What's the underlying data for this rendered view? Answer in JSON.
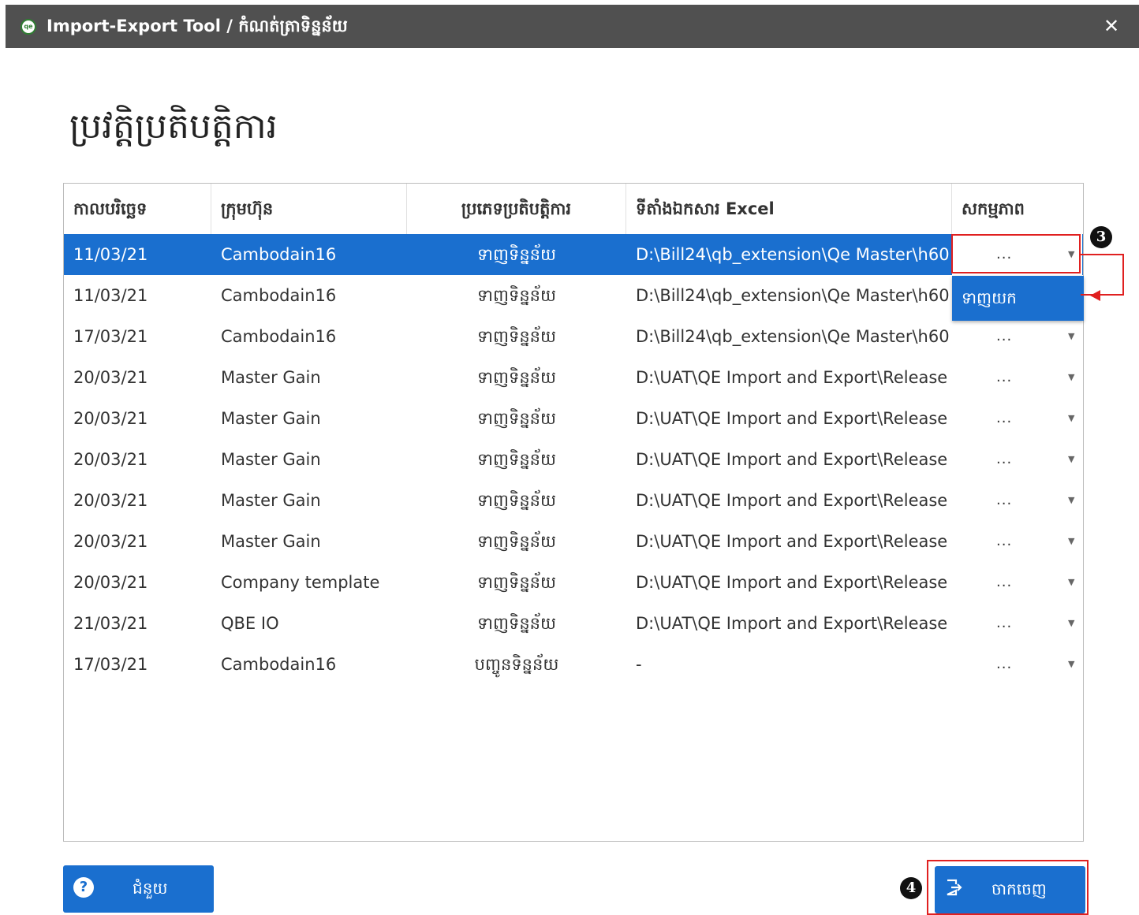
{
  "window": {
    "title": "Import-Export Tool / កំណត់ត្រាទិន្នន័យ",
    "logo_text": "qe",
    "close_glyph": "✕"
  },
  "page": {
    "title": "ប្រវត្តិប្រតិបត្តិការ"
  },
  "table": {
    "headers": [
      "កាលបរិច្ឆេទ",
      "ក្រុមហ៊ុន",
      "ប្រភេទប្រតិបត្តិការ",
      "ទីតាំងឯកសារ Excel",
      "សកម្មភាព"
    ],
    "rows": [
      {
        "date": "11/03/21",
        "company": "Cambodain16",
        "type": "ទាញទិន្នន័យ",
        "path": "D:\\Bill24\\qb_extension\\Qe Master\\h60:",
        "action": "...",
        "selected": true
      },
      {
        "date": "11/03/21",
        "company": "Cambodain16",
        "type": "ទាញទិន្នន័យ",
        "path": "D:\\Bill24\\qb_extension\\Qe Master\\h60:",
        "action": "..."
      },
      {
        "date": "17/03/21",
        "company": "Cambodain16",
        "type": "ទាញទិន្នន័យ",
        "path": "D:\\Bill24\\qb_extension\\Qe Master\\h60:",
        "action": "..."
      },
      {
        "date": "20/03/21",
        "company": "Master Gain",
        "type": "ទាញទិន្នន័យ",
        "path": "D:\\UAT\\QE Import and Export\\Release",
        "action": "..."
      },
      {
        "date": "20/03/21",
        "company": "Master Gain",
        "type": "ទាញទិន្នន័យ",
        "path": "D:\\UAT\\QE Import and Export\\Release",
        "action": "..."
      },
      {
        "date": "20/03/21",
        "company": "Master Gain",
        "type": "ទាញទិន្នន័យ",
        "path": "D:\\UAT\\QE Import and Export\\Release",
        "action": "..."
      },
      {
        "date": "20/03/21",
        "company": "Master Gain",
        "type": "ទាញទិន្នន័យ",
        "path": "D:\\UAT\\QE Import and Export\\Release",
        "action": "..."
      },
      {
        "date": "20/03/21",
        "company": "Master Gain",
        "type": "ទាញទិន្នន័យ",
        "path": "D:\\UAT\\QE Import and Export\\Release",
        "action": "..."
      },
      {
        "date": "20/03/21",
        "company": "Company template",
        "type": "ទាញទិន្នន័យ",
        "path": "D:\\UAT\\QE Import and Export\\Release",
        "action": "..."
      },
      {
        "date": "21/03/21",
        "company": "QBE IO",
        "type": "ទាញទិន្នន័យ",
        "path": "D:\\UAT\\QE Import and Export\\Release",
        "action": "..."
      },
      {
        "date": "17/03/21",
        "company": "Cambodain16",
        "type": "បញ្ចូនទិន្នន័យ",
        "path": "-",
        "action": "..."
      }
    ]
  },
  "dropdown_menu": {
    "item": "ទាញយក"
  },
  "annotations": {
    "step3": "3",
    "step4": "4",
    "highlight_color": "#e02020"
  },
  "buttons": {
    "help": "ជំនួយ",
    "exit": "ចាកចេញ"
  },
  "colors": {
    "accent": "#1a6fcf",
    "titlebar": "#505050"
  },
  "icons": {
    "help": "question-icon",
    "exit": "exit-icon",
    "dropdown": "chevron-down-icon"
  }
}
